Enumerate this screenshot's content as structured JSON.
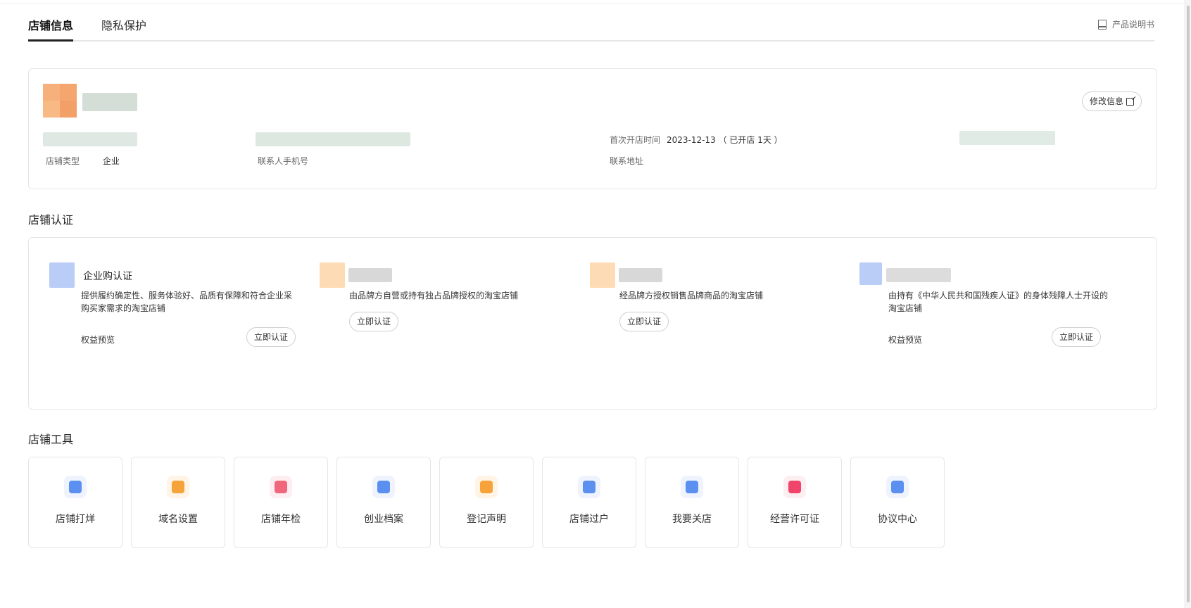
{
  "tabs": [
    {
      "label": "店铺信息",
      "active": true
    },
    {
      "label": "隐私保护",
      "active": false
    }
  ],
  "manual_link": "产品说明书",
  "shop_info": {
    "edit_button": "修改信息",
    "shop_type_label": "店铺类型",
    "shop_type_value": "企业",
    "contact_phone_label": "联系人手机号",
    "open_time_label": "首次开店时间",
    "open_time_value": "2023-12-13 （ 已开店 1天 ）",
    "address_label": "联系地址"
  },
  "cert_section_title": "店铺认证",
  "certs": [
    {
      "title": "企业购认证",
      "desc": "提供履约确定性、服务体验好、品质有保障和符合企业采购买家需求的淘宝店铺",
      "preview": "权益预览",
      "button": "立即认证",
      "icon_color": "#b9cdf7"
    },
    {
      "title": "",
      "desc": "由品牌方自营或持有独占品牌授权的淘宝店铺",
      "preview": "",
      "button": "立即认证",
      "icon_color": "#fddcb5"
    },
    {
      "title": "",
      "desc": "经品牌方授权销售品牌商品的淘宝店铺",
      "preview": "",
      "button": "立即认证",
      "icon_color": "#fddcb5"
    },
    {
      "title": "",
      "desc": "由持有《中华人民共和国残疾人证》的身体残障人士开设的淘宝店铺",
      "preview": "权益预览",
      "button": "立即认证",
      "icon_color": "#b9cdf7"
    }
  ],
  "tools_section_title": "店铺工具",
  "tools": [
    {
      "label": "店铺打烊",
      "icon": "store-close-icon",
      "color": "#5b8ff0",
      "bg": "#eef3fd"
    },
    {
      "label": "域名设置",
      "icon": "domain-icon",
      "color": "#f5a33a",
      "bg": "#fff4e6"
    },
    {
      "label": "店铺年检",
      "icon": "annual-check-icon",
      "color": "#f0677d",
      "bg": "#fdeef1"
    },
    {
      "label": "创业档案",
      "icon": "archive-icon",
      "color": "#5b8ff0",
      "bg": "#eef3fd"
    },
    {
      "label": "登记声明",
      "icon": "registration-icon",
      "color": "#f5a33a",
      "bg": "#fff4e6"
    },
    {
      "label": "店铺过户",
      "icon": "transfer-icon",
      "color": "#5b8ff0",
      "bg": "#eef3fd"
    },
    {
      "label": "我要关店",
      "icon": "close-shop-icon",
      "color": "#5b8ff0",
      "bg": "#eef3fd"
    },
    {
      "label": "经营许可证",
      "icon": "license-icon",
      "color": "#f0446a",
      "bg": "#fdeef1"
    },
    {
      "label": "协议中心",
      "icon": "agreement-icon",
      "color": "#5b8ff0",
      "bg": "#eef3fd"
    }
  ]
}
